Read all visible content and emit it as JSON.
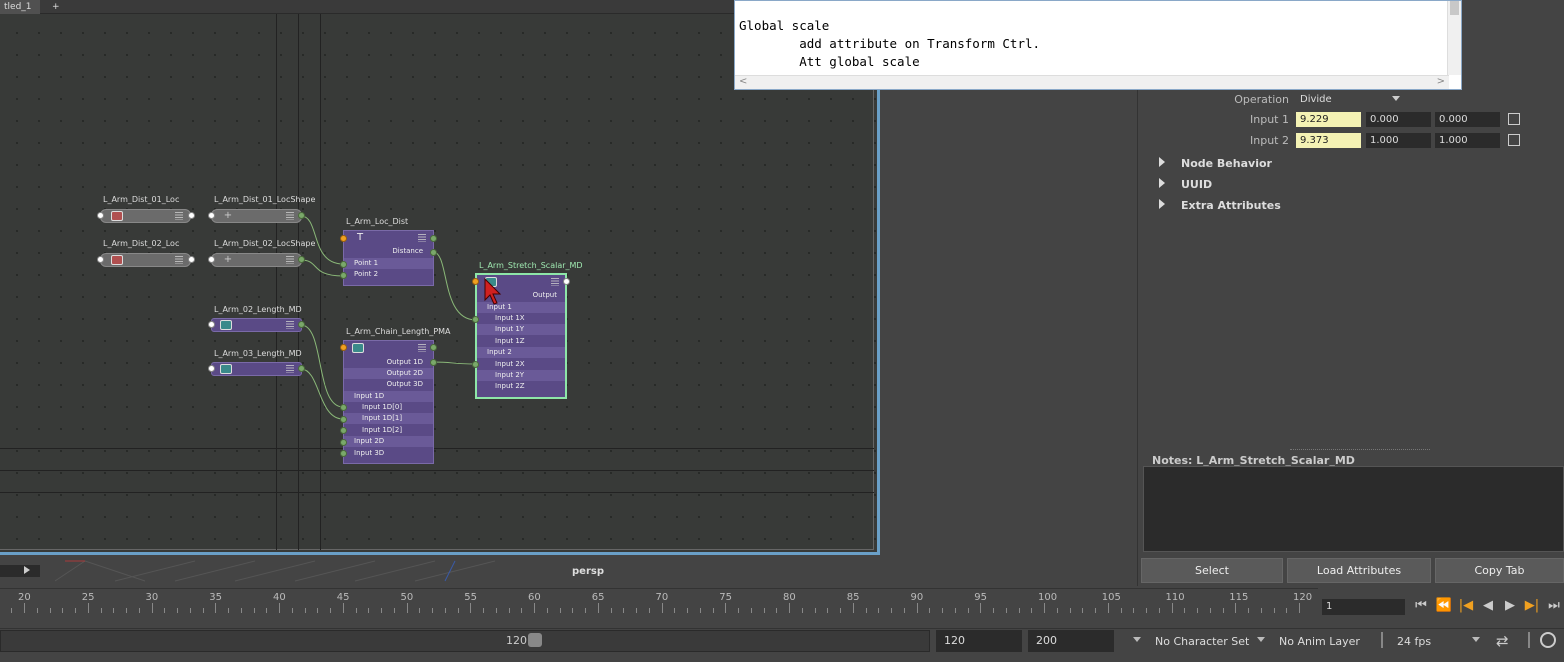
{
  "tabs": {
    "active": "tled_1",
    "add": "+"
  },
  "script_editor": {
    "lines": [
      "Global scale",
      "        add attribute on Transform Ctrl.",
      "        Att global scale"
    ],
    "hscroll_left": "<",
    "hscroll_right": ">"
  },
  "graph": {
    "nodes": {
      "dist01_loc": "L_Arm_Dist_01_Loc",
      "dist01_shape": "L_Arm_Dist_01_LocShape",
      "dist02_loc": "L_Arm_Dist_02_Loc",
      "dist02_shape": "L_Arm_Dist_02_LocShape",
      "length02_md": "L_Arm_02_Length_MD",
      "length03_md": "L_Arm_03_Length_MD",
      "loc_dist": "L_Arm_Loc_Dist",
      "chain_pma": "L_Arm_Chain_Length_PMA",
      "stretch_md": "L_Arm_Stretch_Scalar_MD"
    },
    "loc_dist_rows": [
      "Distance",
      "Point 1",
      "Point 2"
    ],
    "pma_rows": [
      "Output 1D",
      "Output 2D",
      "Output 3D",
      "Input 1D",
      "Input 1D[0]",
      "Input 1D[1]",
      "Input 1D[2]",
      "Input 2D",
      "Input 3D"
    ],
    "md_rows": [
      "Output",
      "Input 1",
      "Input 1X",
      "Input 1Y",
      "Input 1Z",
      "Input 2",
      "Input 2X",
      "Input 2Y",
      "Input 2Z"
    ],
    "loc_icon_glyph": "+",
    "dist_icon_glyph": "T"
  },
  "viewport": {
    "camera": "persp"
  },
  "attribute_editor": {
    "operation_label": "Operation",
    "operation_value": "Divide",
    "input1_label": "Input 1",
    "input1": [
      "9.229",
      "0.000",
      "0.000"
    ],
    "input2_label": "Input 2",
    "input2": [
      "9.373",
      "1.000",
      "1.000"
    ],
    "sections": [
      "Node Behavior",
      "UUID",
      "Extra Attributes"
    ],
    "notes_label": "Notes:  L_Arm_Stretch_Scalar_MD",
    "buttons": {
      "select": "Select",
      "load": "Load Attributes",
      "copy": "Copy Tab"
    }
  },
  "timeline": {
    "ticks": [
      "20",
      "25",
      "30",
      "35",
      "40",
      "45",
      "50",
      "55",
      "60",
      "65",
      "70",
      "75",
      "80",
      "85",
      "90",
      "95",
      "100",
      "105",
      "110",
      "115",
      "120"
    ],
    "current_frame": "1"
  },
  "range": {
    "slider_end": "120",
    "end_field": "120",
    "max_field": "200",
    "character_set": "No Character Set",
    "anim_layer": "No Anim Layer",
    "fps": "24 fps"
  },
  "playback_icons": [
    "first-frame-icon",
    "step-back-key-icon",
    "step-back-icon",
    "play-back-icon",
    "play-forward-icon",
    "step-forward-key-icon",
    "last-frame-icon"
  ]
}
